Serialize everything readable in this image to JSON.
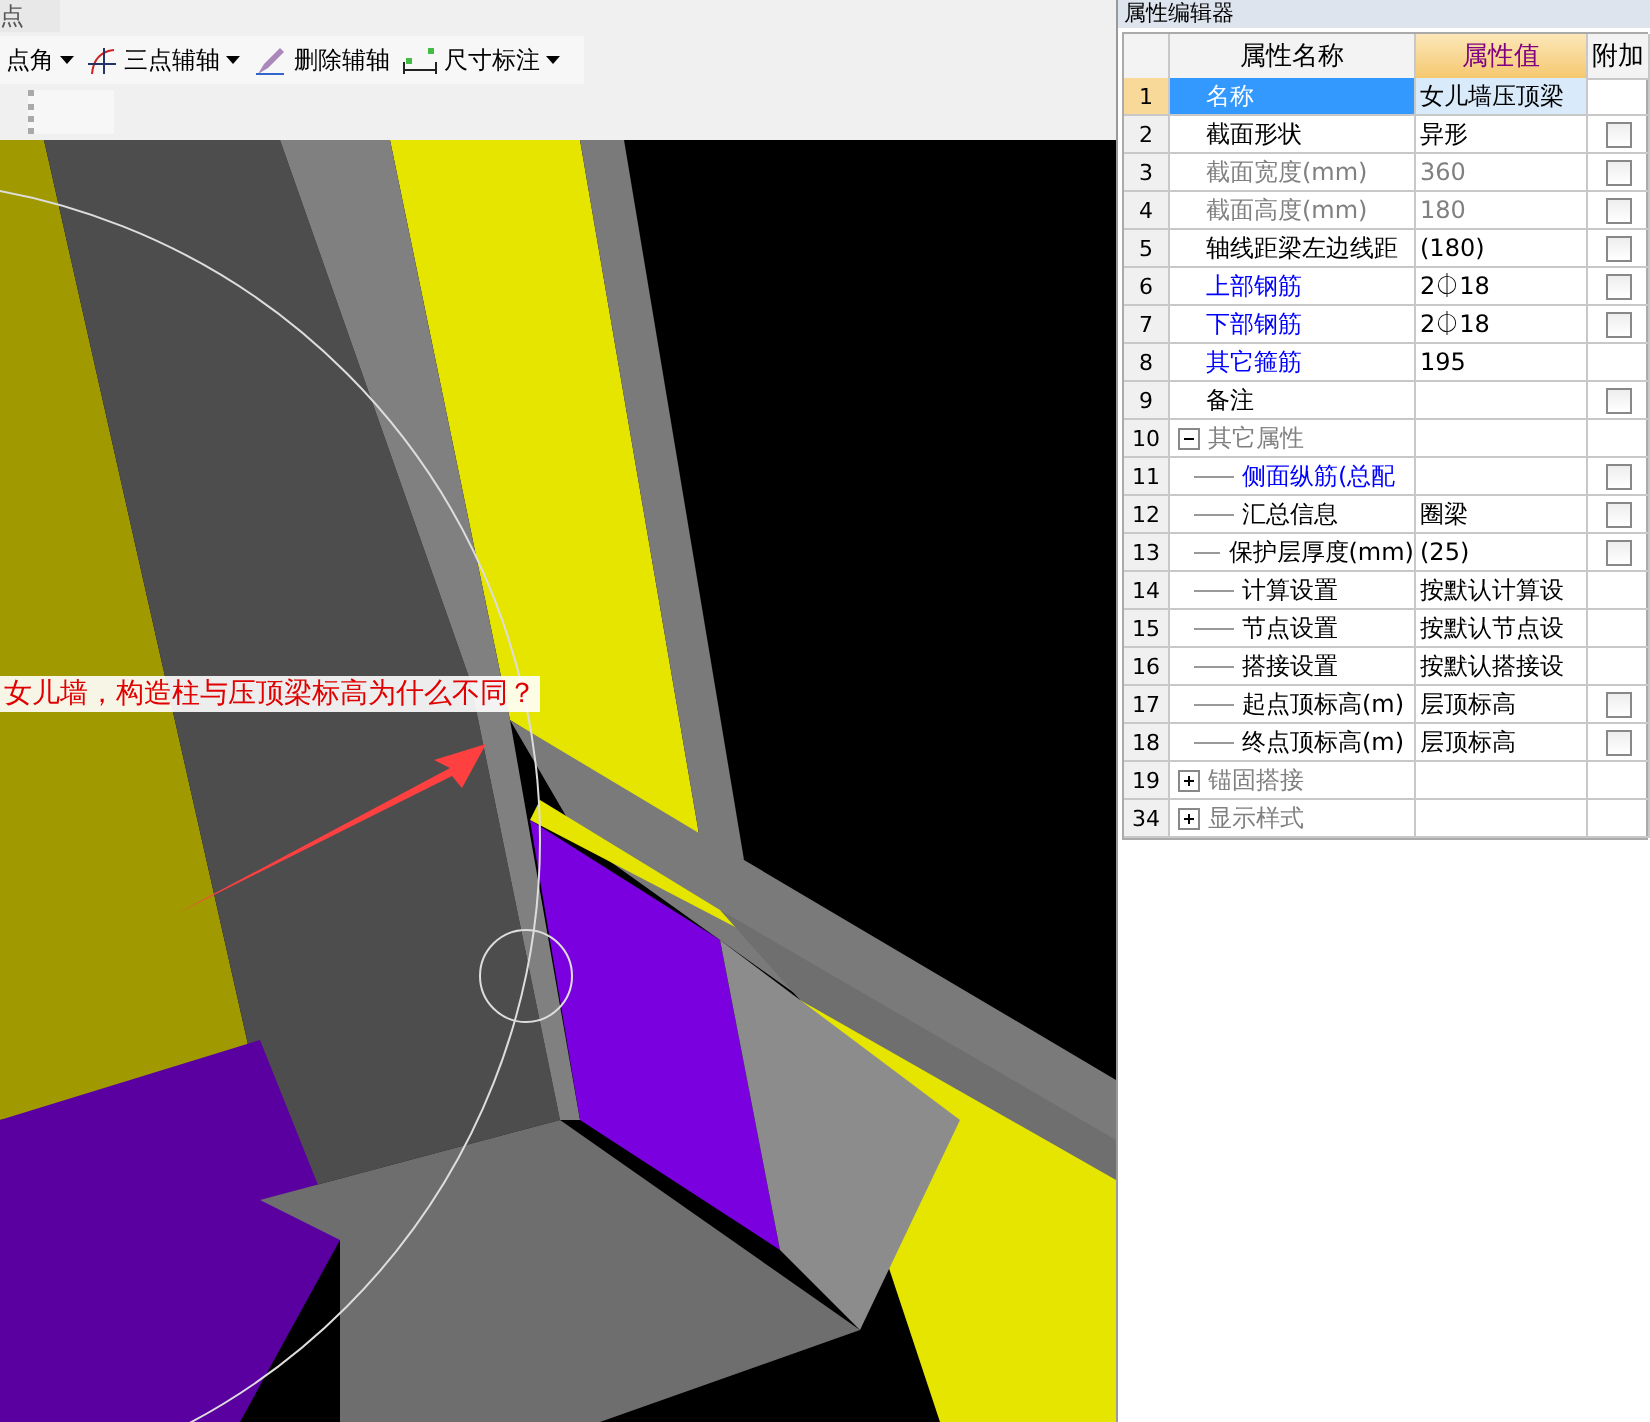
{
  "menu_fragment": "点",
  "toolbar": [
    {
      "label": "点角",
      "dropdown": true
    },
    {
      "label": "三点辅轴",
      "dropdown": true
    },
    {
      "label": "删除辅轴",
      "dropdown": false
    },
    {
      "label": "尺寸标注",
      "dropdown": true
    }
  ],
  "viewport": {
    "annotation": "女儿墙，构造柱与压顶梁标高为什么不同？"
  },
  "panel": {
    "title": "属性编辑器",
    "columns": [
      "属性名称",
      "属性值",
      "附加"
    ],
    "rows": [
      {
        "num": "1",
        "name": "名称",
        "value": "女儿墙压顶梁",
        "selected": true
      },
      {
        "num": "2",
        "name": "截面形状",
        "value": "异形",
        "color": "#000000",
        "selected": false,
        "checked": false
      },
      {
        "num": "3",
        "name": "截面宽度(mm)",
        "value": "360",
        "disabled": true,
        "selected": false,
        "checked": false
      },
      {
        "num": "4",
        "name": "截面高度(mm)",
        "value": "180",
        "disabled": true,
        "selected": false,
        "checked": false
      },
      {
        "num": "5",
        "name": "轴线距梁左边线距",
        "value": "(180)",
        "color": "#000000",
        "selected": false,
        "checked": false
      },
      {
        "num": "6",
        "name": "上部钢筋",
        "value": "2⏀18",
        "color": "#0000ff",
        "selected": false,
        "checked": false
      },
      {
        "num": "7",
        "name": "下部钢筋",
        "value": "2⏀18",
        "color": "#0000ff",
        "selected": false,
        "checked": false
      },
      {
        "num": "8",
        "name": "其它箍筋",
        "value": "195",
        "color": "#0000ff",
        "selected": false
      },
      {
        "num": "9",
        "name": "备注",
        "color": "#000000",
        "selected": false,
        "checked": false
      },
      {
        "num": "10",
        "name": "其它属性",
        "kind": "group",
        "expanded": true,
        "selected": false,
        "children": [
          {
            "num": "11",
            "name": "侧面纵筋(总配",
            "color": "#0000ff",
            "selected": false,
            "checked": false
          },
          {
            "num": "12",
            "name": "汇总信息",
            "value": "圈梁",
            "color": "#000000",
            "selected": false,
            "checked": false
          },
          {
            "num": "13",
            "name": "保护层厚度(mm)",
            "value": "(25)",
            "color": "#000000",
            "selected": false,
            "checked": false
          },
          {
            "num": "14",
            "name": "计算设置",
            "value": "按默认计算设",
            "color": "#000000",
            "selected": false
          },
          {
            "num": "15",
            "name": "节点设置",
            "value": "按默认节点设",
            "color": "#000000",
            "selected": false
          },
          {
            "num": "16",
            "name": "搭接设置",
            "value": "按默认搭接设",
            "color": "#000000",
            "selected": false
          },
          {
            "num": "17",
            "name": "起点顶标高(m)",
            "value": "层顶标高",
            "color": "#000000",
            "selected": false,
            "checked": false
          },
          {
            "num": "18",
            "name": "终点顶标高(m)",
            "value": "层顶标高",
            "color": "#000000",
            "selected": false,
            "checked": false
          }
        ]
      },
      {
        "num": "19",
        "name": "锚固搭接",
        "kind": "group",
        "expanded": false,
        "selected": false
      },
      {
        "num": "34",
        "name": "显示样式",
        "kind": "group",
        "expanded": false,
        "selected": false
      }
    ]
  }
}
